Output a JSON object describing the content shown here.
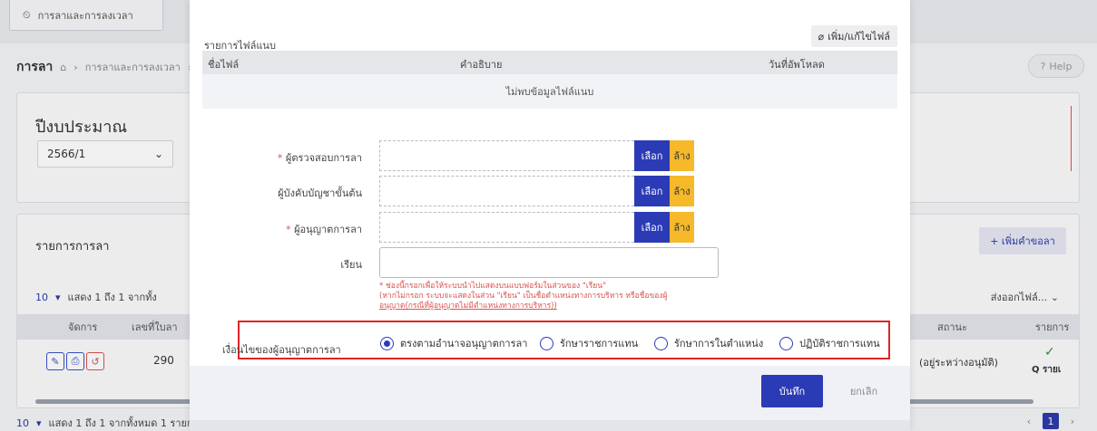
{
  "background": {
    "top_tab": "การลาและการลงเวลา",
    "breadcrumb": {
      "main": "การลา",
      "home_item": "การลาและการลงเวลา",
      "truncated_item": "ก"
    },
    "help_label": "Help",
    "budget_card": {
      "title": "ปีงบประมาณ",
      "selected_year": "2566/1"
    },
    "leave_list_card": {
      "title": "รายการการลา",
      "add_button": "+ เพิ่มคำขอลา",
      "page_size": "10",
      "showing_text": "แสดง 1 ถึง 1 จากทั้ง",
      "export_label": "ส่งออกไฟล์...",
      "columns": {
        "manage": "จัดการ",
        "leave_number": "เลขที่ใบลา",
        "status": "สถานะ",
        "list": "รายการ"
      },
      "row": {
        "leave_number": "290",
        "status": "(อยู่ระหว่างอนุมัติ)",
        "view": "Q รายเ"
      },
      "footer_page_size": "10",
      "footer_text": "แสดง 1 ถึง 1 จากทั้งหมด 1 รายการ",
      "current_page": "1"
    }
  },
  "modal": {
    "attachments_label": "รายการไฟล์แนบ",
    "edit_file_button": "เพิ่ม/แก้ไขไฟล์",
    "file_table": {
      "headers": [
        "ชื่อไฟล์",
        "คำอธิบาย",
        "วันที่อัพโหลด"
      ],
      "empty_text": "ไม่พบข้อมูลไฟล์แนบ"
    },
    "fields": {
      "inspector": {
        "label": "ผู้ตรวจสอบการลา",
        "required_mark": "*"
      },
      "supervisor": {
        "label": "ผู้บังคับบัญชาขั้นต้น"
      },
      "approver": {
        "label": "ผู้อนุญาตการลา",
        "required_mark": "*"
      },
      "rian": {
        "label": "เรียน"
      }
    },
    "select_label": "เลือก",
    "clear_label": "ล้าง",
    "note_lines": [
      "* ช่องนี้กรอกเพื่อให้ระบบนำไปแสดงบนแบบฟอร์มในส่วนของ \"เรียน\"",
      "(หากไม่กรอก ระบบจะแสดงในส่วน \"เรียน\" เป็นชื่อตำแหน่งทางการบริหาร หรือชื่อของผู้",
      "อนุญาต(กรณีที่ผู้อนุญาตไม่มีตำแหน่งทางการบริหาร))"
    ],
    "approver_condition": {
      "label": "เงื่อนไขของผู้อนุญาตการลา",
      "options": [
        {
          "label": "ตรงตามอำนาจอนุญาตการลา",
          "selected": true
        },
        {
          "label": "รักษาราชการแทน",
          "selected": false
        },
        {
          "label": "รักษาการในตำแหน่ง",
          "selected": false
        },
        {
          "label": "ปฏิบัติราชการแทน",
          "selected": false
        }
      ]
    },
    "save_button": "บันทึก",
    "cancel_button": "ยกเลิก"
  },
  "colors": {
    "primary": "#2b3bb5",
    "clear": "#f5b92a",
    "required": "#d9534f",
    "highlight_border": "#e02424"
  }
}
